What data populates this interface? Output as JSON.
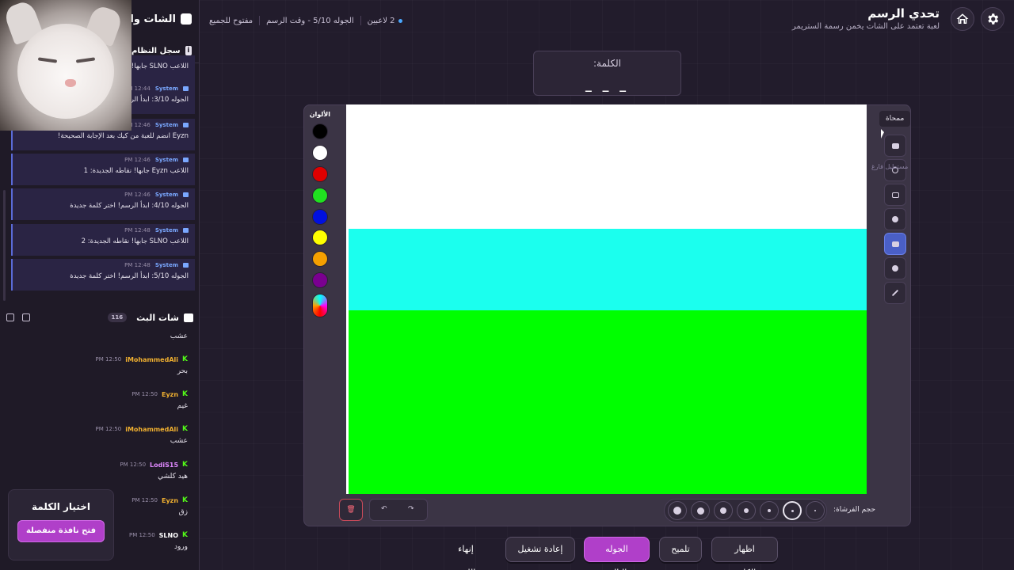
{
  "header": {
    "title": "تحدي الرسم",
    "subtitle": "لعبة تعتمد على الشات يخمن رسمة الستريمر",
    "status": {
      "players": "2 لاعبين",
      "round": "الجوله 5/10 - وقت الرسم",
      "mode": "مفتوح للجميع"
    },
    "icons": {
      "settings": "gear-icon",
      "home": "home-icon"
    }
  },
  "left_panel": {
    "title": "الشات والب",
    "system_log_title": "سجل النظام",
    "system_messages": [
      {
        "who": "",
        "time": "",
        "text": "اللاعب SLNO جابها! نقاطه الجديدة: 1"
      },
      {
        "who": "System",
        "time": "12:44 PM",
        "text": "الجوله 3/10: ابدأ الرسم! اختر كلمة جديدة"
      },
      {
        "who": "System",
        "time": "12:46 PM",
        "text": "Eyzn انضم للعبة من كيك بعد الإجابة الصحيحة!"
      },
      {
        "who": "System",
        "time": "12:46 PM",
        "text": "اللاعب Eyzn جابها! نقاطه الجديدة: 1"
      },
      {
        "who": "System",
        "time": "12:46 PM",
        "text": "الجوله 4/10: ابدأ الرسم! اختر كلمة جديدة"
      },
      {
        "who": "System",
        "time": "12:48 PM",
        "text": "اللاعب SLNO جابها! نقاطه الجديدة: 2"
      },
      {
        "who": "System",
        "time": "12:48 PM",
        "text": "الجوله 5/10: ابدأ الرسم! اختر كلمة جديدة"
      }
    ],
    "chat_title": "شات البث",
    "chat_count": "116",
    "chat_top_text": "عشب",
    "chat_messages": [
      {
        "user": "iMohammedAli",
        "color": "#f0b030",
        "time": "12:50 PM",
        "text": "بحر"
      },
      {
        "user": "Eyzn",
        "color": "#f0b030",
        "time": "12:50 PM",
        "text": "غيم"
      },
      {
        "user": "iMohammedAli",
        "color": "#f0b030",
        "time": "12:50 PM",
        "text": "عشب"
      },
      {
        "user": "LodiS15",
        "color": "#e08aff",
        "time": "12:50 PM",
        "text": "هيد كلشي"
      },
      {
        "user": "Eyzn",
        "color": "#f0b030",
        "time": "12:50 PM",
        "text": "زق"
      },
      {
        "user": "SLNO",
        "color": "#ffffff",
        "time": "12:50 PM",
        "text": "ورود"
      }
    ],
    "pick_word": {
      "title": "اختيار الكلمة",
      "button": "فتح نافذة منفصلة"
    }
  },
  "word": {
    "label": "الكلمة:",
    "value": "_ _ _"
  },
  "palette": {
    "label": "الألوان",
    "colors": [
      "#000000",
      "#ffffff",
      "#e00000",
      "#20e020",
      "#0010e0",
      "#ffff00",
      "#f5a000",
      "#7a0090"
    ]
  },
  "canvas": {
    "top_color": "#ffffff",
    "middle_color": "#1bffee",
    "bottom_color": "#00ff00"
  },
  "tools": {
    "tooltip": "ممحاة",
    "ghost_tooltip": "مستطيل فارغ",
    "items": [
      "eraser-icon",
      "circle-outline-icon",
      "rectangle-outline-icon",
      "circle-filled-icon",
      "rectangle-filled-icon",
      "fill-bucket-icon",
      "line-icon"
    ]
  },
  "brush": {
    "label": "حجم الفرشاة:"
  },
  "actions": {
    "show_word": "اظهار الكلمة",
    "hint": "تلميح",
    "next_round": "الجوله التالية",
    "restart": "إعادة تشغيل",
    "end_game": "إنهاء اللعبة"
  }
}
